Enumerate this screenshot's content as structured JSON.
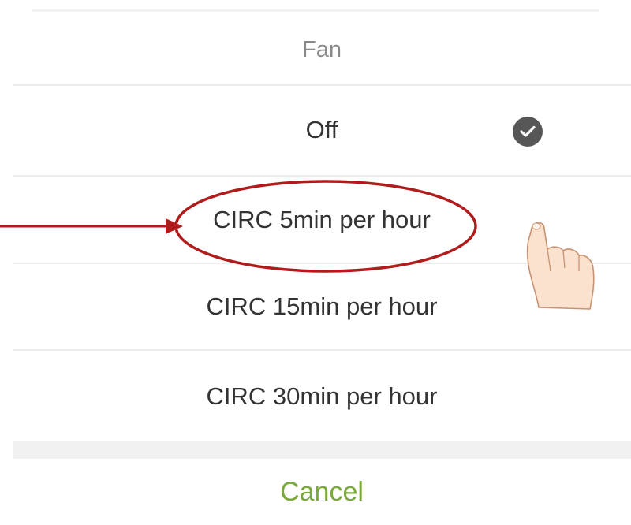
{
  "sheet": {
    "title": "Fan",
    "options": [
      {
        "label": "Off",
        "selected": true
      },
      {
        "label": "CIRC 5min per hour",
        "selected": false,
        "highlighted": true
      },
      {
        "label": "CIRC 15min per hour",
        "selected": false
      },
      {
        "label": "CIRC 30min per hour",
        "selected": false
      }
    ],
    "cancel_label": "Cancel"
  },
  "colors": {
    "cancel_text": "#7aa83b",
    "annotation": "#b01c1c",
    "check_badge": "#575757"
  },
  "icons": {
    "selected": "check-circle-icon",
    "pointer": "pointing-hand-icon",
    "annotation_arrow": "arrow-right-icon"
  }
}
